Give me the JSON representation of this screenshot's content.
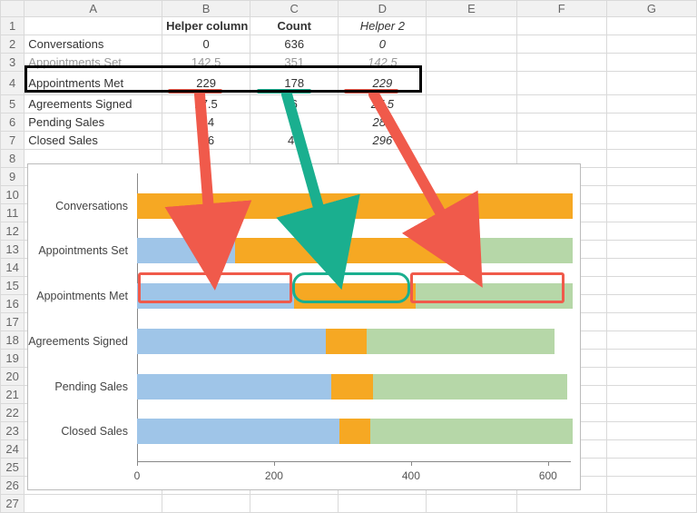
{
  "columns": [
    "A",
    "B",
    "C",
    "D",
    "E",
    "F",
    "G"
  ],
  "headers": {
    "A": "",
    "B": "Helper column",
    "C": "Count",
    "D": "Helper 2"
  },
  "rows": [
    {
      "label": "Conversations",
      "helper": "0",
      "count": "636",
      "helper2": "0"
    },
    {
      "label": "Appointments Set",
      "helper": "142.5",
      "count": "351",
      "helper2": "142.5"
    },
    {
      "label": "Appointments Met",
      "helper": "229",
      "count": "178",
      "helper2": "229"
    },
    {
      "label": "Agreements Signed",
      "helper": "27.5",
      "count": "6",
      "helper2": "27.5"
    },
    {
      "label": "Pending Sales",
      "helper": "2 4",
      "count": "6",
      "helper2": "284"
    },
    {
      "label": "Closed Sales",
      "helper": "2 6",
      "count": "44",
      "helper2": "296"
    }
  ],
  "row_obscured_index": 1,
  "row_selected_index": 2,
  "chart_data": {
    "type": "bar",
    "orientation": "horizontal",
    "stacked": true,
    "categories": [
      "Conversations",
      "Appointments Set",
      "Appointments Met",
      "Agreements Signed",
      "Pending Sales",
      "Closed Sales"
    ],
    "series": [
      {
        "name": "Helper column",
        "color": "#9fc5e8",
        "values": [
          0,
          142.5,
          229,
          275,
          284,
          296
        ]
      },
      {
        "name": "Count",
        "color": "#f6a823",
        "values": [
          636,
          351,
          178,
          60,
          60,
          44
        ]
      },
      {
        "name": "Helper 2",
        "color": "#b6d7a8",
        "values": [
          0,
          142.5,
          229,
          275,
          284,
          296
        ]
      }
    ],
    "xlim": [
      0,
      636
    ],
    "xticks": [
      0,
      200,
      400,
      600
    ],
    "xlabel": "",
    "ylabel": ""
  },
  "annotations": {
    "arrows": [
      {
        "from": "cell-B4",
        "to": "chart-helper-segment-appointments-met",
        "color": "#f05a4b"
      },
      {
        "from": "cell-C4",
        "to": "chart-count-segment-appointments-met",
        "color": "#1aaf8f"
      },
      {
        "from": "cell-D4",
        "to": "chart-helper2-segment-appointments-met",
        "color": "#f05a4b"
      }
    ]
  }
}
